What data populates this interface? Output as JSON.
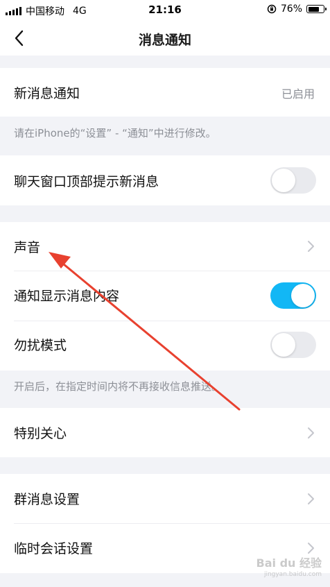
{
  "status_bar": {
    "carrier": "中国移动",
    "network": "4G",
    "time": "21:16",
    "battery": "76%",
    "battery_level": 0.76
  },
  "nav": {
    "title": "消息通知",
    "back_icon": "chevron-left-icon"
  },
  "rows": {
    "new_message": {
      "label": "新消息通知",
      "value": "已启用"
    },
    "hint_iphone": "请在iPhone的“设置” - “通知”中进行修改。",
    "top_banner": {
      "label": "聊天窗口顶部提示新消息",
      "enabled": false
    },
    "sound": {
      "label": "声音"
    },
    "show_content": {
      "label": "通知显示消息内容",
      "enabled": true
    },
    "dnd": {
      "label": "勿扰模式",
      "enabled": false
    },
    "hint_dnd": "开启后，在指定时间内将不再接收信息推送。",
    "special_care": {
      "label": "特别关心"
    },
    "group_settings": {
      "label": "群消息设置"
    },
    "temp_chat": {
      "label": "临时会话设置"
    }
  },
  "watermark": {
    "brand": "Bai du 经验",
    "url": "jingyan.baidu.com"
  },
  "colors": {
    "accent": "#12b7f5",
    "arrow": "#e8412f",
    "background": "#f2f3f7"
  }
}
